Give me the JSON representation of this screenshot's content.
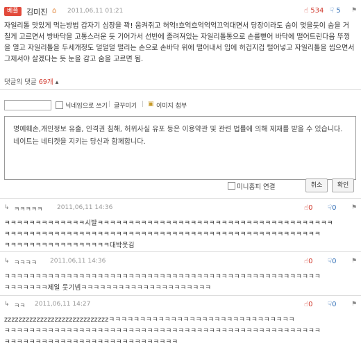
{
  "comment": {
    "badge": "베플",
    "author": "김미진",
    "house_icon": "home-icon",
    "date": "2011,06,11 01:21",
    "up": "534",
    "down": "5",
    "body": "자일리톨 맛있게 먹는방법   갑자기 심장을 꽉! 움켜쥐고 허억!흐억흐억억억끄억대면서 당장이라도 숨이 멎을듯이 숨을 거칠게 고르면서 방바닥을 고통스러운 듯 기어가서 선반에 졸려져있는 자일리톨통으로 손를뻗어 바닥에 떨어트린다음 뚜껑을 열고 자일리톨을 두세개정도 덜덜덜 떨리는 손으로 손바닥 위에 떨어내서 입에 허겁지겁 털어넣고 자일리톨을 씹으면서 그제서야 살겠다는 듯 눈을 감고 숨을 고르면 됨.",
    "replies_label": "댓글의 댓글",
    "replies_count": "69개"
  },
  "reply_form": {
    "nickname_label": "닉네임으로 쓰기",
    "decor_label": "글꾸미기",
    "image_label": "이미지 첨부",
    "notice": "명예훼손,개인정보 유출, 인격권 침해, 허위사실 유포 등은 이용약관 및 관련 법률에 의해 제재를 받을 수 있습니다. 네이트는 네티켓을 지키는 당신과 함께합니다.",
    "minihp_label": "미니홈피 연결",
    "cancel_label": "취소",
    "confirm_label": "확인"
  },
  "replies": [
    {
      "author": "ㅋㅋㅋㅋㅋ",
      "date": "2011,06,11 14:36",
      "up": "0",
      "down": "0",
      "lines": [
        "ㅋㅋㅋㅋㅋㅋㅋㅋㅋㅋㅋㅋㅋ시발ㅋㅋㅋㅋㅋㅋㅋㅋㅋㅋㅋㅋㅋㅋㅋㅋㅋㅋㅋㅋㅋㅋㅋㅋㅋㅋㅋㅋㅋㅋㅋㅋㅋㅋㅋㅋㅋㅋ",
        "ㅋㅋㅋㅋㅋㅋㅋㅋㅋㅋㅋㅋㅋㅋㅋㅋㅋㅋㅋㅋㅋㅋㅋㅋㅋㅋㅋㅋㅋㅋㅋㅋㅋㅋㅋㅋㅋㅋㅋㅋㅋㅋㅋㅋㅋㅋㅋㅋㅋㅋㅋ",
        "ㅋㅋㅋㅋㅋㅋㅋㅋㅋㅋㅋㅋㅋㅋㅋㅋㅋ대박웃김"
      ]
    },
    {
      "author": "ㅋㅋㅋㅋ",
      "date": "2011,06,11 14:36",
      "up": "0",
      "down": "0",
      "lines": [
        "ㅋㅋㅋㅋㅋㅋㅋㅋㅋㅋㅋㅋㅋㅋㅋㅋㅋㅋㅋㅋㅋㅋㅋㅋㅋㅋㅋㅋㅋㅋㅋㅋㅋㅋㅋㅋㅋㅋㅋㅋㅋㅋㅋㅋㅋㅋㅋㅋㅋㅋㅋ",
        "ㅋㅋㅋㅋㅋㅋㅋ제일 웃기넴ㅋㅋㅋㅋㅋㅋㅋㅋㅋㅋㅋㅋㅋㅋㅋㅋㅋㅋㅋㅋㅋ"
      ]
    },
    {
      "author": "ㅋㅋ",
      "date": "2011,06,11 14:27",
      "up": "0",
      "down": "0",
      "lines": [
        "zzzzzzzzzzzzzzzzzzzzzzzzzzzzzㅋㅋㅋㅋㅋㅋㅋㅋㅋㅋㅋㅋㅋㅋㅋㅋㅋㅋㅋㅋㅋㅋㅋㅋㅋㅋㅋㅋㅋㅋ",
        "ㅋㅋㅋㅋㅋㅋㅋㅋㅋㅋㅋㅋㅋㅋㅋㅋㅋㅋㅋㅋㅋㅋㅋㅋㅋㅋㅋㅋㅋㅋㅋㅋㅋㅋㅋㅋㅋㅋㅋㅋㅋㅋㅋㅋㅋㅋㅋㅋㅋㅋㅋ",
        "ㅋㅋㅋㅋㅋㅋㅋㅋㅋㅋㅋㅋㅋㅋㅋㅋㅋㅋㅋㅋㅋㅋㅋㅋㅋㅋㅋㅋ"
      ]
    }
  ],
  "colors": {
    "badge": "#e24a3b",
    "up": "#d13b2f",
    "down": "#2f6db5"
  }
}
